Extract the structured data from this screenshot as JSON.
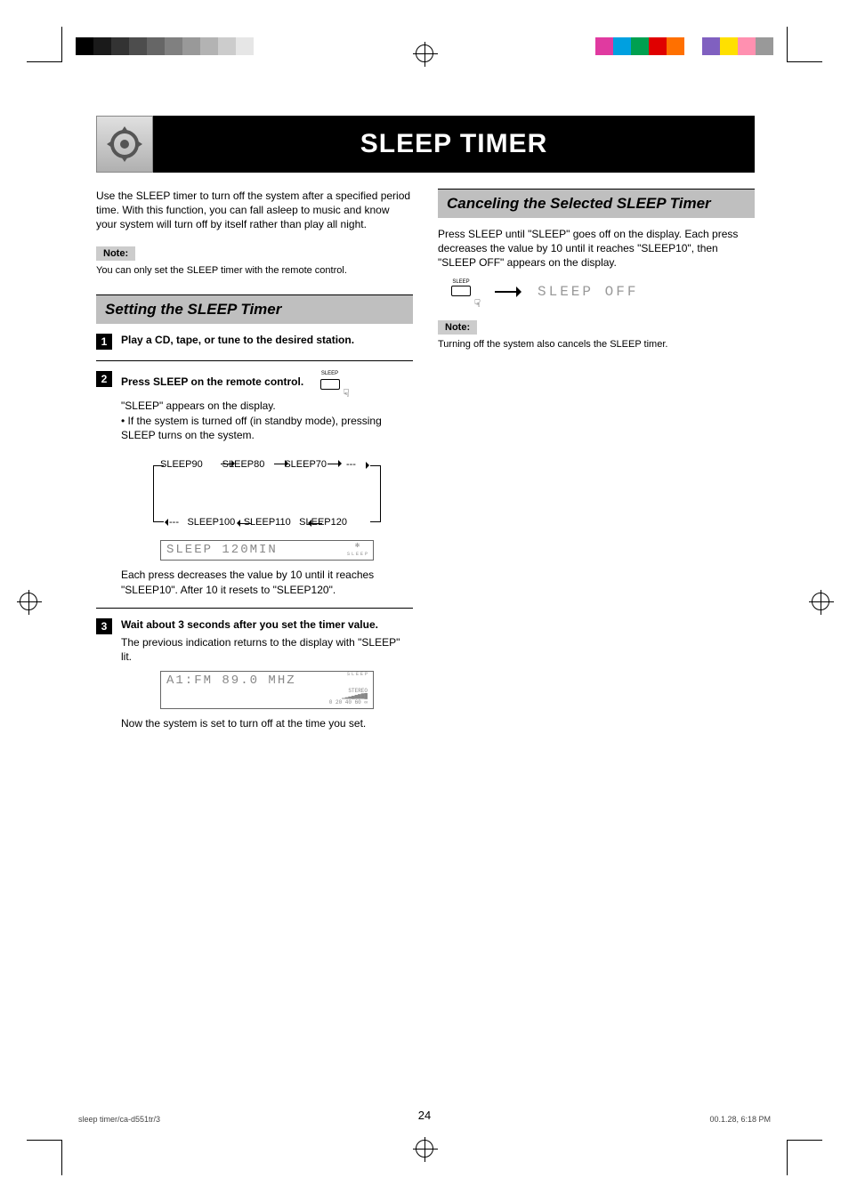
{
  "title": "SLEEP TIMER",
  "intro": "Use the SLEEP timer to turn off the system after a specified period time. With this function, you can fall asleep to music and know your system will turn off by itself rather than play all night.",
  "note1_label": "Note:",
  "note1_text": "You can only set the SLEEP timer with the remote control.",
  "section_setting": "Setting the SLEEP Timer",
  "steps": {
    "s1": {
      "title": "Play a CD, tape, or tune to the desired station."
    },
    "s2": {
      "title": "Press SLEEP on the remote control.",
      "desc": "\"SLEEP\" appears on the display.\n• If the system is turned off (in standby mode), pressing SLEEP turns on the system.",
      "cycle_top": [
        "SLEEP90",
        "SLEEP80",
        "SLEEP70",
        "---"
      ],
      "cycle_bottom": [
        "SLEEP120",
        "SLEEP110",
        "SLEEP100",
        "---"
      ],
      "display": "SLEEP 120MIN",
      "after": "Each press decreases the value by 10 until it reaches \"SLEEP10\". After 10 it resets to \"SLEEP120\"."
    },
    "s3": {
      "title": "Wait about 3 seconds after you set the timer value.",
      "desc": "The previous indication returns to the display with \"SLEEP\" lit.",
      "display": "A1:FM 89.0 MHZ",
      "display_sub1": "SLEEP",
      "display_sub2": "STEREO",
      "display_meter": "0 20 40 60 ∞",
      "after": "Now the system is set to turn off at the time you set."
    }
  },
  "section_cancel": "Canceling the Selected SLEEP Timer",
  "cancel_text": "Press SLEEP until \"SLEEP\" goes off on the display. Each press decreases the value by 10 until it reaches \"SLEEP10\", then \"SLEEP OFF\" appears on the display.",
  "cancel_display": "SLEEP OFF",
  "note2_label": "Note:",
  "note2_text": "Turning off the system also cancels the SLEEP timer.",
  "page_number": "24",
  "footer_left": "sleep timer/ca-d551tr/3",
  "footer_right": "00.1.28, 6:18 PM",
  "sleep_btn_label": "SLEEP",
  "colorbar_left": [
    "#000",
    "#1a1a1a",
    "#333",
    "#4d4d4d",
    "#666",
    "#808080",
    "#999",
    "#b3b3b3",
    "#ccc",
    "#e6e6e6",
    "#fff"
  ],
  "colorbar_right": [
    "#e03aa0",
    "#00a0e0",
    "#00a050",
    "#e00000",
    "#ff7000",
    "#fff",
    "#8060c0",
    "#ffe000",
    "#ff90b0",
    "#999"
  ]
}
